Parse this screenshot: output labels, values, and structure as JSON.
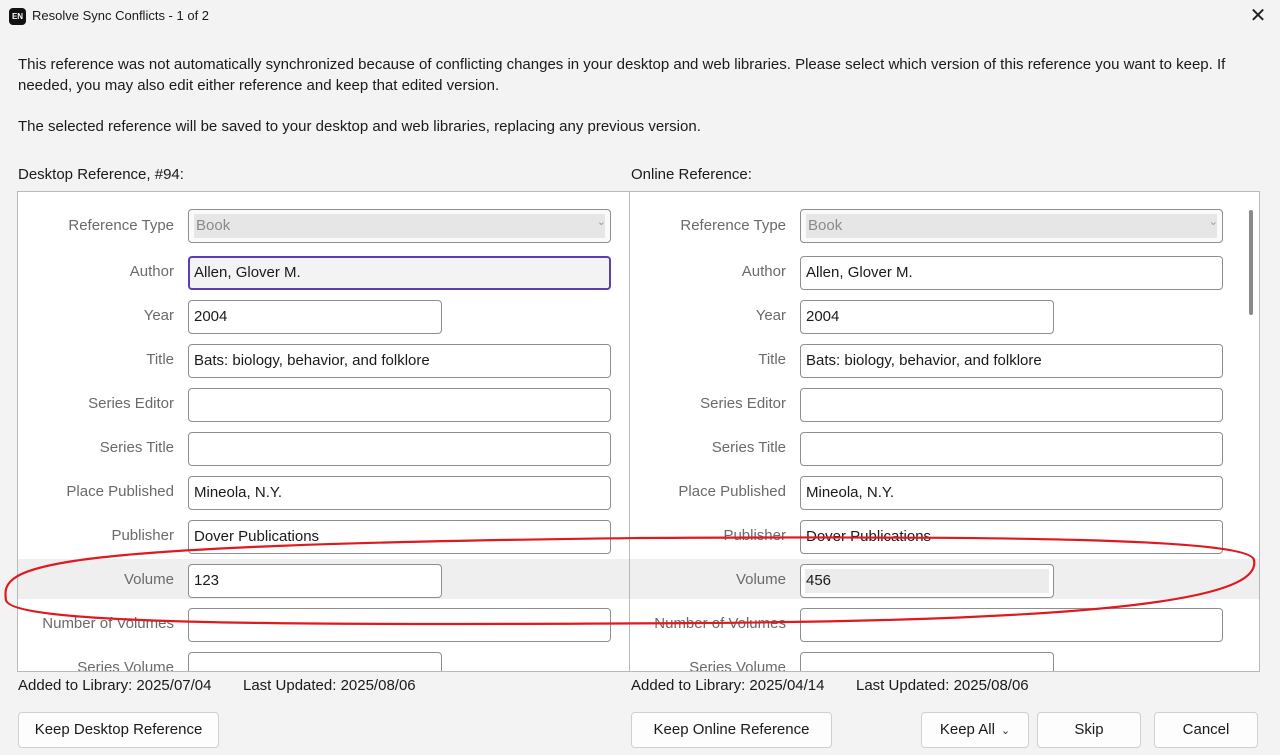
{
  "window": {
    "app_icon_text": "EN",
    "title": "Resolve Sync Conflicts - 1 of 2",
    "close_glyph": "✕"
  },
  "intro": {
    "line1": "This reference was not automatically synchronized because of conflicting changes in your desktop and web libraries. Please select which version of this reference you want to keep. If needed, you may also edit either reference and keep that edited version.",
    "line2": "The selected reference will be saved to your desktop and web libraries, replacing any previous version."
  },
  "desktop": {
    "label": "Desktop Reference, #94:",
    "fields": {
      "reference_type_label": "Reference Type",
      "reference_type": "Book",
      "author_label": "Author",
      "author": "Allen, Glover M.",
      "year_label": "Year",
      "year": "2004",
      "title_label": "Title",
      "title": "Bats: biology, behavior, and folklore",
      "series_editor_label": "Series Editor",
      "series_editor": "",
      "series_title_label": "Series Title",
      "series_title": "",
      "place_published_label": "Place Published",
      "place_published": "Mineola, N.Y.",
      "publisher_label": "Publisher",
      "publisher": "Dover Publications",
      "volume_label": "Volume",
      "volume": "123",
      "number_of_volumes_label": "Number of Volumes",
      "number_of_volumes": "",
      "series_volume_label": "Series Volume",
      "series_volume": ""
    },
    "added": "Added to Library: 2025/07/04",
    "updated": "Last Updated: 2025/08/06"
  },
  "online": {
    "label": "Online Reference:",
    "fields": {
      "reference_type_label": "Reference Type",
      "reference_type": "Book",
      "author_label": "Author",
      "author": "Allen, Glover M.",
      "year_label": "Year",
      "year": "2004",
      "title_label": "Title",
      "title": "Bats: biology, behavior, and folklore",
      "series_editor_label": "Series Editor",
      "series_editor": "",
      "series_title_label": "Series Title",
      "series_title": "",
      "place_published_label": "Place Published",
      "place_published": "Mineola, N.Y.",
      "publisher_label": "Publisher",
      "publisher": "Dover Publications",
      "volume_label": "Volume",
      "volume": "456",
      "number_of_volumes_label": "Number of Volumes",
      "number_of_volumes": "",
      "series_volume_label": "Series Volume",
      "series_volume": ""
    },
    "added": "Added to Library: 2025/04/14",
    "updated": "Last Updated: 2025/08/06"
  },
  "buttons": {
    "keep_desktop": "Keep Desktop Reference",
    "keep_online": "Keep Online Reference",
    "keep_all": "Keep All",
    "skip": "Skip",
    "cancel": "Cancel"
  },
  "colors": {
    "annotation_red": "#e0191e",
    "focus_border": "#5b3fb0"
  }
}
